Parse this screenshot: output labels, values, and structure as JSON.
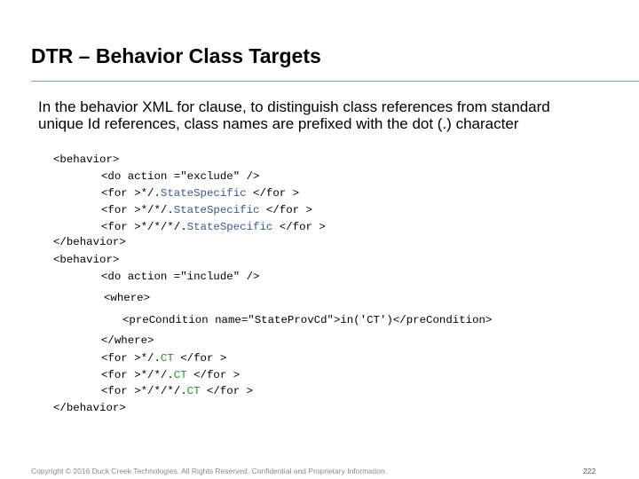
{
  "title": "DTR – Behavior Class Targets",
  "intro": {
    "line1": "In the behavior XML for clause, to distinguish class references from standard",
    "line2": "unique Id references, class names are prefixed with the dot (.) character"
  },
  "code": {
    "l1": "<behavior>",
    "l2": "<do action =\"exclude\" />",
    "l3_pre": "<for >*/.",
    "l3_cls": "StateSpecific",
    "l3_post": " </for >",
    "l4_pre": "<for >*/*/.",
    "l4_cls": "StateSpecific",
    "l4_post": " </for >",
    "l5_pre": "<for >*/*/*/.",
    "l5_cls": "StateSpecific",
    "l5_post": " </for >",
    "l6": "</behavior>",
    "l7": "<behavior>",
    "l8": "<do action =\"include\" />",
    "l9": "<where>",
    "l10": "<preCondition name=\"StateProvCd\">in('CT')</preCondition>",
    "l11": "</where>",
    "l12_pre": "<for >*/.",
    "l12_cls": "CT",
    "l12_post": " </for >",
    "l13_pre": "<for >*/*/.",
    "l13_cls": "CT",
    "l13_post": " </for >",
    "l14_pre": "<for >*/*/*/.",
    "l14_cls": "CT",
    "l14_post": " </for >",
    "l15": "</behavior>"
  },
  "footer": {
    "copyright": "Copyright © 2016 Duck Creek Technologies. All Rights Reserved. Confidential and Proprietary Information.",
    "page_number": "222"
  },
  "colors": {
    "class_name": "#3c5a86",
    "ct_name": "#2e8b2e",
    "rule": "#7aa6b6"
  }
}
